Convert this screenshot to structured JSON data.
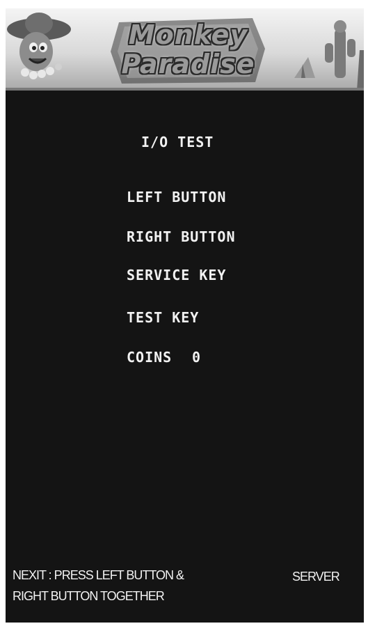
{
  "banner": {
    "logo_line1": "Monkey",
    "logo_line2": "Paradise"
  },
  "screen": {
    "title": "I/O TEST",
    "items": [
      {
        "label": "LEFT BUTTON"
      },
      {
        "label": "RIGHT BUTTON"
      },
      {
        "label": "SERVICE KEY"
      },
      {
        "label": "TEST KEY"
      },
      {
        "label": "COINS",
        "value": "0"
      }
    ]
  },
  "footer": {
    "instruction_line1": "NEXIT : PRESS LEFT BUTTON &",
    "instruction_line2": "RIGHT BUTTON TOGETHER",
    "mode": "SERVER"
  },
  "colors": {
    "screen_bg": "#141414",
    "text": "#f2f2f2"
  }
}
